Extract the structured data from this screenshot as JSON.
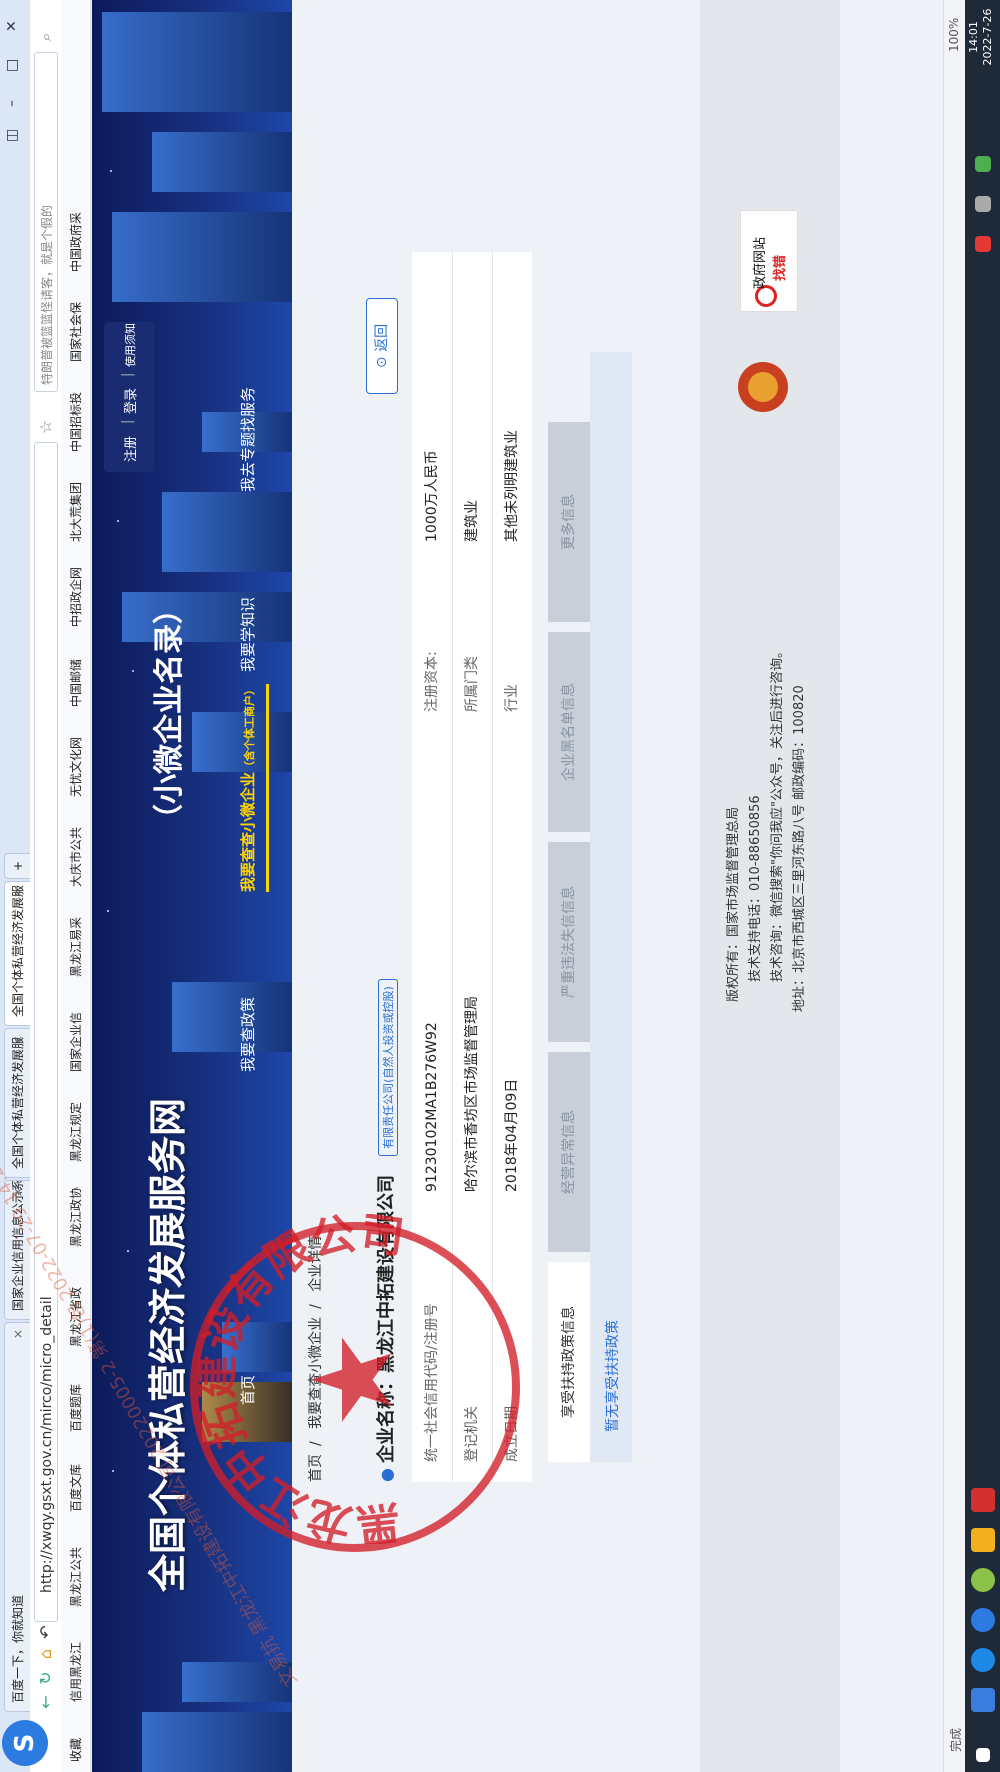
{
  "browser": {
    "tabs": [
      {
        "label": "百度一下，你就知道"
      },
      {
        "label": "国家企业信用信息公示系"
      },
      {
        "label": "全国个体私营经济发展服"
      },
      {
        "label": "全国个体私营经济发展服"
      }
    ],
    "url": "http://xwqy.gsxt.gov.cn/mirco/micro_detail",
    "search_placeholder": "特朗普被篮篮怪请客，就是个假的",
    "bookmarks": [
      "收藏",
      "信用黑龙江",
      "黑龙江公共",
      "百度文库",
      "百度题库",
      "黑龙江省政",
      "黑龙江政协",
      "黑龙江规定",
      "国家企业信",
      "黑龙江易采",
      "大庆市公共",
      "无忧文化网",
      "中国邮储",
      "中招政企网",
      "北大荒集团",
      "中国招标投",
      "国家社会保",
      "中国政府采"
    ],
    "status_text": "完成",
    "zoom": "100%",
    "clock_time": "14:01",
    "clock_date": "2022-7-26"
  },
  "banner": {
    "title": "全国个体私营经济发展服务网",
    "subtitle": "（小微企业名录）",
    "user_links": [
      "注册",
      "登录",
      "使用须知"
    ],
    "nav": [
      "首页",
      "我要查政策",
      "我要查查小微企业",
      "（含个体工商户）",
      "我要学知识",
      "我去专题找服务"
    ]
  },
  "breadcrumb": [
    "首页",
    "我要查查小微企业",
    "企业详情"
  ],
  "company": {
    "label": "企业名称：",
    "name": "黑龙江中拓建设有限公司",
    "type_tag": "有限责任公司(自然人投资或控股)",
    "back_label": "返回",
    "fields": [
      {
        "label": "统一社会信用代码/注册号",
        "value": "91230102MA1B276W92"
      },
      {
        "label": "登记机关",
        "value": "哈尔滨市香坊区市场监督管理局"
      },
      {
        "label": "成立日期",
        "value": "2018年04月09日"
      },
      {
        "label": "注册资本:",
        "value": "1000万人民币"
      },
      {
        "label": "所属门类",
        "value": "建筑业"
      },
      {
        "label": "行业",
        "value": "其他未列明建筑业"
      }
    ]
  },
  "detail_tabs": [
    "享受扶持政策信息",
    "经营异常信息",
    "严重违法失信信息",
    "企业黑名单信息",
    "更多信息"
  ],
  "policy_text": "暂无享受扶持政策",
  "footer": {
    "lines": [
      "版权所有：国家市场监督管理总局",
      "技术支持电话：010-88650856",
      "技术咨询：微信搜索\"你问我应\"公众号，关注后进行咨询。",
      "地址：北京市西城区三里河东路八号 邮政编码：100820"
    ],
    "gov_site": [
      "政府网站",
      "找错"
    ]
  },
  "stamp": {
    "text": "黑龙江中拓建设有限公司"
  },
  "watermark": "文易抗 黑龙江中拓建设有限公司 20220005-2 第(1)包 2022-07-29 14:22:11"
}
